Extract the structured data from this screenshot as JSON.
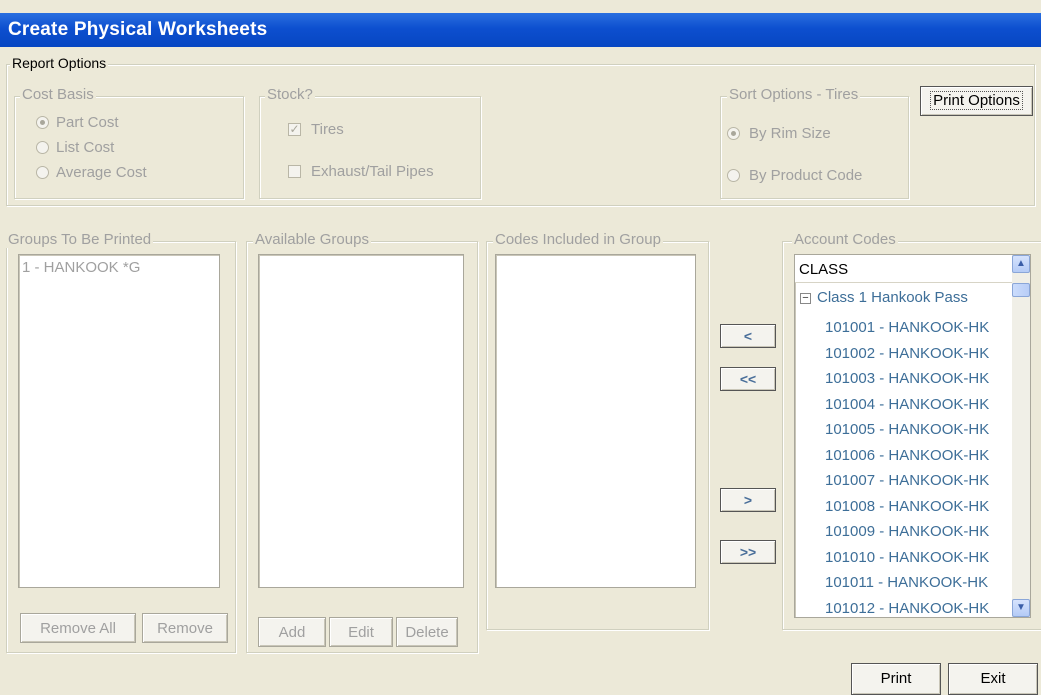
{
  "window": {
    "title": "Create Physical Worksheets"
  },
  "report_options": {
    "legend": "Report Options",
    "cost_basis": {
      "legend": "Cost Basis",
      "options": [
        {
          "label": "Part Cost",
          "selected": true
        },
        {
          "label": "List Cost",
          "selected": false
        },
        {
          "label": "Average Cost",
          "selected": false
        }
      ]
    },
    "stock": {
      "legend": "Stock?",
      "options": [
        {
          "label": "Tires",
          "checked": true
        },
        {
          "label": "Exhaust/Tail Pipes",
          "checked": false
        }
      ]
    },
    "sort_options": {
      "legend": "Sort Options - Tires",
      "options": [
        {
          "label": "By Rim Size",
          "selected": true
        },
        {
          "label": "By Product Code",
          "selected": false
        }
      ]
    },
    "print_options_label": "Print Options"
  },
  "groups_to_print": {
    "legend": "Groups To Be Printed",
    "items": [
      "1 - HANKOOK *G"
    ],
    "remove_all_label": "Remove All",
    "remove_label": "Remove"
  },
  "available_groups": {
    "legend": "Available Groups",
    "items": [],
    "add_label": "Add",
    "edit_label": "Edit",
    "delete_label": "Delete"
  },
  "codes_in_group": {
    "legend": "Codes Included in Group",
    "items": []
  },
  "transfer_buttons": {
    "remove_one": "<",
    "remove_all": "<<",
    "add_one": ">",
    "add_all": ">>"
  },
  "account_codes": {
    "legend": "Account Codes",
    "header": "CLASS",
    "parent": {
      "expander": "−",
      "label": "Class 1 Hankook Pass"
    },
    "children": [
      "101001 - HANKOOK-HK",
      "101002 - HANKOOK-HK",
      "101003 - HANKOOK-HK",
      "101004 - HANKOOK-HK",
      "101005 - HANKOOK-HK",
      "101006 - HANKOOK-HK",
      "101007 - HANKOOK-HK",
      "101008 - HANKOOK-HK",
      "101009 - HANKOOK-HK",
      "101010 - HANKOOK-HK",
      "101011 - HANKOOK-HK",
      "101012 - HANKOOK-HK"
    ],
    "scroll_up": "▲",
    "scroll_down": "▼"
  },
  "footer": {
    "print_label": "Print",
    "exit_label": "Exit"
  },
  "colors": {
    "title_bar": "#0d4fcf",
    "tree_text": "#3d6e98",
    "disabled_text": "#a0a0a0"
  }
}
